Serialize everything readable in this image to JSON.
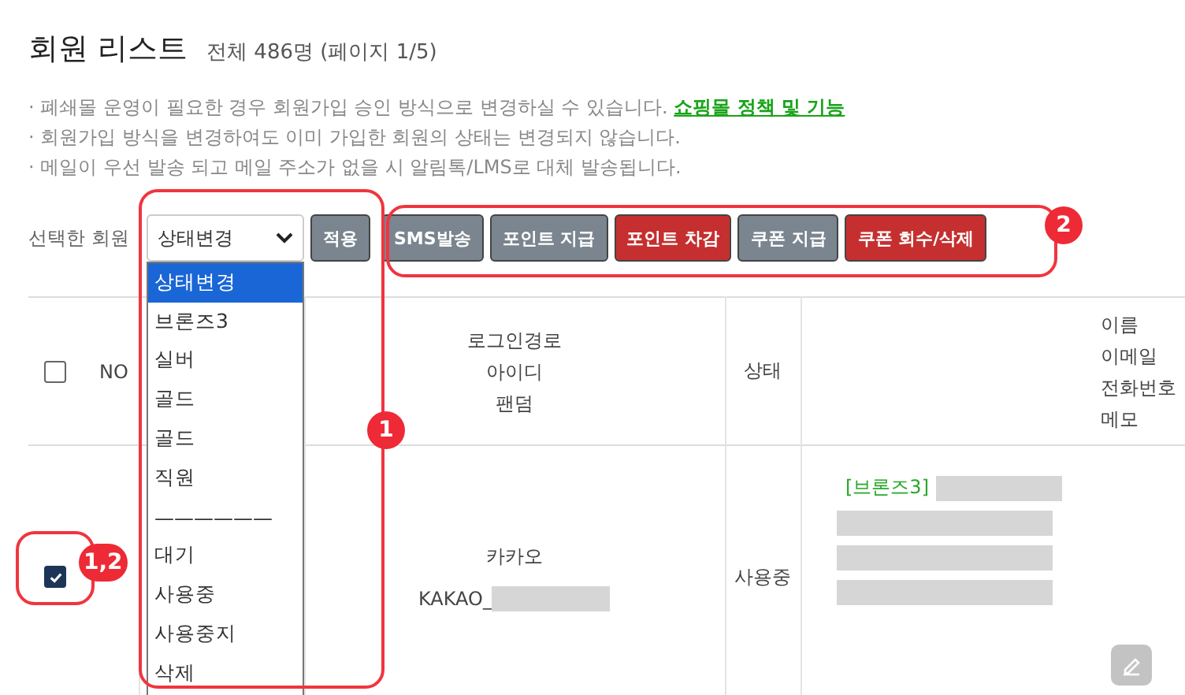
{
  "page": {
    "title": "회원 리스트",
    "summary": "전체 486명 (페이지 1/5)"
  },
  "notes": [
    {
      "text": "· 폐쇄몰 운영이 필요한 경우 회원가입 승인 방식으로 변경하실 수 있습니다.",
      "link": "쇼핑몰 정책 및 기능"
    },
    {
      "text": "· 회원가입 방식을 변경하여도 이미 가입한 회원의 상태는 변경되지 않습니다."
    },
    {
      "text": "· 메일이 우선 발송 되고 메일 주소가 없을 시 알림톡/LMS로 대체 발송됩니다."
    }
  ],
  "toolbar": {
    "label": "선택한 회원",
    "select": {
      "value": "상태변경",
      "expanded": true,
      "options": [
        {
          "kind": "option",
          "label": "상태변경",
          "selected": true
        },
        {
          "kind": "option",
          "label": "브론즈3",
          "selected": false
        },
        {
          "kind": "option",
          "label": "실버",
          "selected": false
        },
        {
          "kind": "option",
          "label": "골드",
          "selected": false
        },
        {
          "kind": "option",
          "label": "골드",
          "selected": false
        },
        {
          "kind": "option",
          "label": "직원",
          "selected": false
        },
        {
          "kind": "separator",
          "label": "——————"
        },
        {
          "kind": "option",
          "label": "대기",
          "selected": false
        },
        {
          "kind": "option",
          "label": "사용중",
          "selected": false
        },
        {
          "kind": "option",
          "label": "사용중지",
          "selected": false
        },
        {
          "kind": "option",
          "label": "삭제",
          "selected": false
        }
      ]
    },
    "buttons": [
      {
        "label": "적용",
        "kind": "gray"
      },
      {
        "label": "SMS발송",
        "kind": "gray"
      },
      {
        "label": "포인트 지급",
        "kind": "gray"
      },
      {
        "label": "포인트 차감",
        "kind": "red"
      },
      {
        "label": "쿠폰 지급",
        "kind": "gray"
      },
      {
        "label": "쿠폰 회수/삭제",
        "kind": "red"
      }
    ]
  },
  "table": {
    "header": {
      "checked": false,
      "no": "NO",
      "login": [
        "로그인경로",
        "아이디",
        "팬덤"
      ],
      "status": "상태",
      "info": [
        "이름",
        "이메일",
        "전화번호",
        "메모"
      ]
    },
    "rows": [
      {
        "checked": true,
        "login": "카카오",
        "id": "KAKAO_",
        "status": "사용중",
        "grade": "[브론즈3]"
      }
    ]
  },
  "annotations": [
    {
      "label": "1"
    },
    {
      "label": "2"
    },
    {
      "label": "1,2"
    }
  ]
}
